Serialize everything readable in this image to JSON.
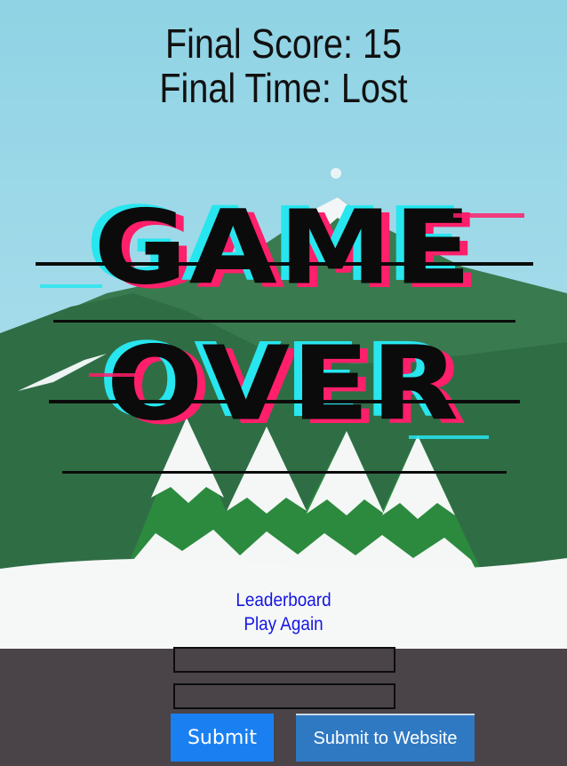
{
  "game": {
    "final_score_label": "Final Score: 15",
    "final_time_label": "Final Time: Lost",
    "game_over_line1": "GAME",
    "game_over_line2": "OVER"
  },
  "menu": {
    "leaderboard_label": "Leaderboard",
    "play_again_label": "Play Again"
  },
  "submit_form": {
    "field1_value": "",
    "field2_value": "",
    "submit_label": "Submit",
    "submit_website_label": "Submit to Website"
  },
  "colors": {
    "sky": "#8fd3e4",
    "mountain": "#2f6e45",
    "snow": "#f6f8f8",
    "glitch_cyan": "#27e6ef",
    "glitch_magenta": "#ff1f6b",
    "link": "#1515e0",
    "submit_button": "#1a80f2",
    "website_button": "#2f79c3",
    "panel": "#4a4347"
  }
}
